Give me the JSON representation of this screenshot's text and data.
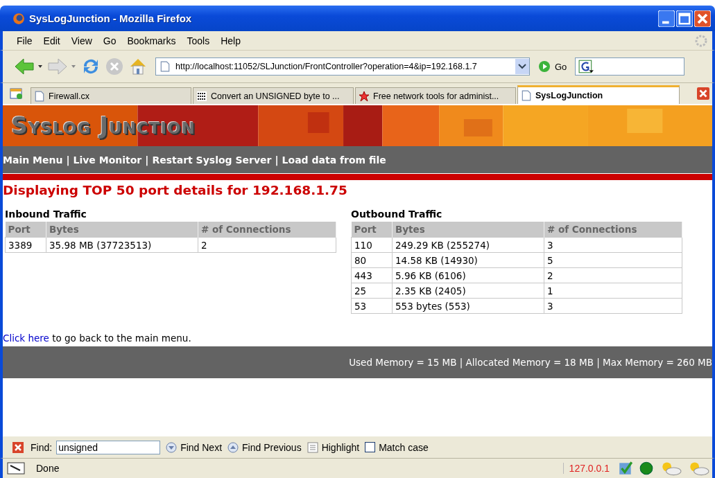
{
  "window": {
    "title": "SysLogJunction - Mozilla Firefox"
  },
  "menu": [
    "File",
    "Edit",
    "View",
    "Go",
    "Bookmarks",
    "Tools",
    "Help"
  ],
  "toolbar": {
    "url": "http://localhost:11052/SLJunction/FrontController?operation=4&ip=192.168.1.7",
    "go": "Go"
  },
  "tabs": [
    {
      "label": "Firewall.cx",
      "kind": "page",
      "selected": false
    },
    {
      "label": "Convert an UNSIGNED byte to ...",
      "kind": "site",
      "selected": false
    },
    {
      "label": "Free network tools for administ...",
      "kind": "star",
      "selected": false
    },
    {
      "label": "SysLogJunction",
      "kind": "page",
      "selected": true
    }
  ],
  "page": {
    "logo": "Syslog Junction",
    "nav": [
      "Main Menu",
      "Live Monitor",
      "Restart Syslog Server",
      "Load data from file"
    ],
    "nav_separator": "|",
    "heading": "Displaying TOP 50 port details for 192.168.1.75",
    "tables": [
      {
        "title": "Inbound Traffic",
        "columns": [
          "Port",
          "Bytes",
          "# of Connections"
        ],
        "rows": [
          [
            "3389",
            "35.98 MB (37723513)",
            "2"
          ]
        ]
      },
      {
        "title": "Outbound Traffic",
        "columns": [
          "Port",
          "Bytes",
          "# of Connections"
        ],
        "rows": [
          [
            "110",
            "249.29 KB (255274)",
            "3"
          ],
          [
            "80",
            "14.58 KB (14930)",
            "5"
          ],
          [
            "443",
            "5.96 KB (6106)",
            "2"
          ],
          [
            "25",
            "2.35 KB (2405)",
            "1"
          ],
          [
            "53",
            "553 bytes (553)",
            "3"
          ]
        ]
      }
    ],
    "back_link": "Click here",
    "back_text": "to go back to the main menu.",
    "footer": "Used Memory = 15 MB | Allocated Memory = 18 MB | Max Memory = 260 MB"
  },
  "find_bar": {
    "label": "Find:",
    "value": "unsigned",
    "next": "Find Next",
    "previous": "Find Previous",
    "highlight": "Highlight",
    "match_case": "Match case",
    "match_case_checked": false
  },
  "status_bar": {
    "text": "Done",
    "ip": "127.0.0.1"
  }
}
